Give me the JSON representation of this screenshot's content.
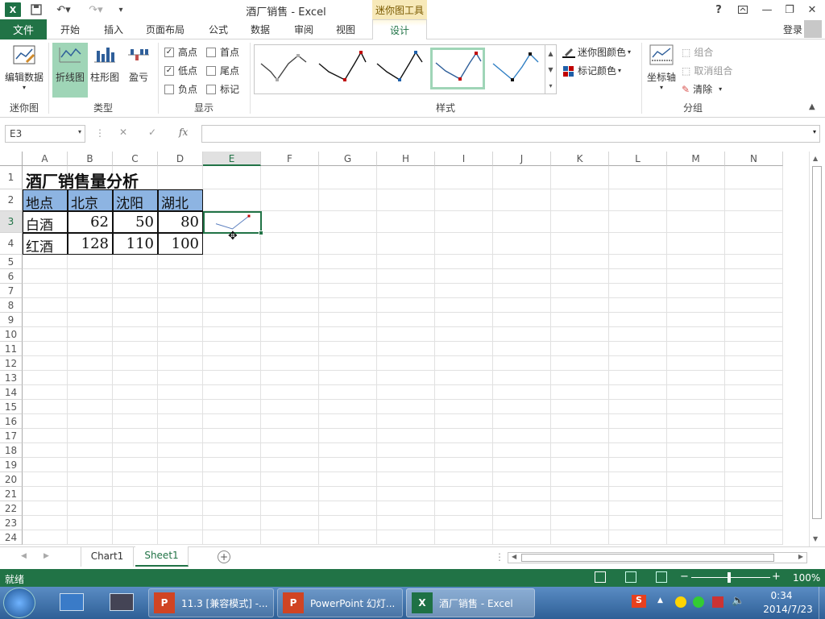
{
  "window": {
    "title": "酒厂销售 - Excel",
    "context_tab_title": "迷你图工具",
    "login": "登录"
  },
  "tabs": [
    "文件",
    "开始",
    "插入",
    "页面布局",
    "公式",
    "数据",
    "审阅",
    "视图",
    "设计"
  ],
  "ribbon": {
    "edit_data": "编辑数据",
    "group_sparkline": "迷你图",
    "type_line": "折线图",
    "type_column": "柱形图",
    "type_winloss": "盈亏",
    "group_type": "类型",
    "show": {
      "high": "高点",
      "low": "低点",
      "negative": "负点",
      "first": "首点",
      "last": "尾点",
      "markers": "标记",
      "high_checked": true,
      "low_checked": true
    },
    "group_show": "显示",
    "group_style": "样式",
    "sparkline_color": "迷你图颜色",
    "marker_color": "标记颜色",
    "axis": "坐标轴",
    "group": "组合",
    "ungroup": "取消组合",
    "clear": "清除",
    "group_group": "分组"
  },
  "formula_bar": {
    "name_box": "E3",
    "fx": "fx",
    "value": ""
  },
  "columns": [
    "A",
    "B",
    "C",
    "D",
    "E",
    "F",
    "G",
    "H",
    "I",
    "J",
    "K",
    "L",
    "M",
    "N"
  ],
  "rows": [
    "1",
    "2",
    "3",
    "4",
    "5",
    "6",
    "7",
    "8",
    "9",
    "10",
    "11",
    "12",
    "13",
    "14",
    "15",
    "16",
    "17",
    "18",
    "19",
    "20",
    "21",
    "22",
    "23",
    "24"
  ],
  "sheet": {
    "title": "酒厂销售量分析",
    "headers": [
      "地点",
      "北京",
      "沈阳",
      "湖北"
    ],
    "data": [
      [
        "白酒",
        "62",
        "50",
        "80"
      ],
      [
        "红酒",
        "128",
        "110",
        "100"
      ]
    ],
    "sparkline_values": [
      62,
      50,
      80
    ]
  },
  "sheet_tabs": [
    "Chart1",
    "Sheet1"
  ],
  "active_sheet": "Sheet1",
  "status": {
    "ready": "就绪",
    "zoom": "100%"
  },
  "taskbar": {
    "items": [
      "11.3 [兼容模式] -...",
      "PowerPoint 幻灯...",
      "酒厂销售 - Excel"
    ],
    "time": "0:34",
    "date": "2014/7/23"
  },
  "colors": {
    "excel_green": "#217346",
    "header_fill": "#8db4e2",
    "context_tab": "#f7e9b9"
  }
}
